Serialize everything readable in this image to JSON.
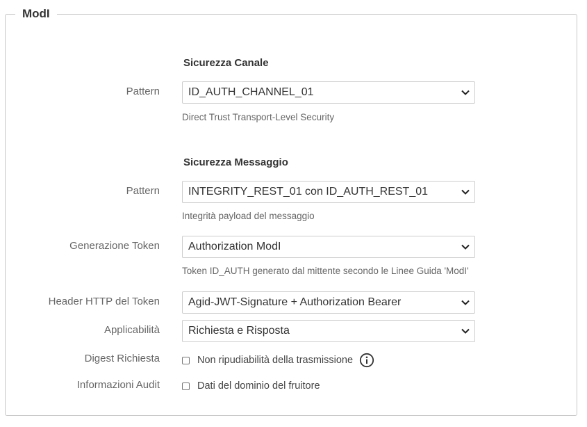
{
  "fieldset": {
    "legend": "ModI"
  },
  "channel_security": {
    "title": "Sicurezza Canale",
    "pattern_label": "Pattern",
    "pattern_value": "ID_AUTH_CHANNEL_01",
    "pattern_help": "Direct Trust Transport-Level Security"
  },
  "message_security": {
    "title": "Sicurezza Messaggio",
    "pattern_label": "Pattern",
    "pattern_value": "INTEGRITY_REST_01 con ID_AUTH_REST_01",
    "pattern_help": "Integrità payload del messaggio",
    "token_generation_label": "Generazione Token",
    "token_generation_value": "Authorization ModI",
    "token_generation_help": "Token ID_AUTH generato dal mittente secondo le Linee Guida 'ModI'",
    "http_header_label": "Header HTTP del Token",
    "http_header_value": "Agid-JWT-Signature + Authorization Bearer",
    "applicability_label": "Applicabilità",
    "applicability_value": "Richiesta e Risposta",
    "digest_label": "Digest Richiesta",
    "digest_checkbox_label": "Non ripudiabilità della trasmissione",
    "digest_checked": false,
    "audit_label": "Informazioni Audit",
    "audit_checkbox_label": "Dati del dominio del fruitore",
    "audit_checked": false
  },
  "icons": {
    "select_arrow": "chevron-down-icon",
    "info": "info-icon"
  }
}
